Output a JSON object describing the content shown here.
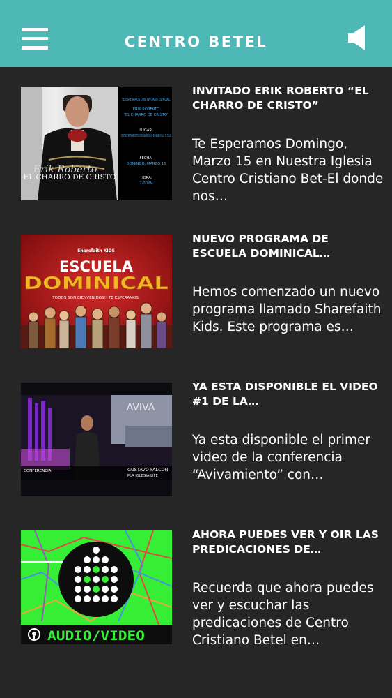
{
  "header": {
    "title": "CENTRO BETEL",
    "menu_icon": "hamburger-menu-icon",
    "sound_icon": "speaker-icon",
    "accent_color": "#4eb8b6"
  },
  "posts": [
    {
      "title": "INVITADO ERIK ROBERTO “EL CHARRO DE CRISTO”",
      "excerpt": "Te Esperamos Domingo, Marzo 15 en Nuestra Iglesia Centro Cristiano Bet-El donde nos…",
      "thumb": {
        "invite": "TE ESPERAMOS CON INVITADO ESPECIAL:",
        "guest": "ERIK ROBERTO",
        "nickname": "\"EL CHARRO DE CRISTO\"",
        "place_label": "LUGAR:",
        "place": "CENTRO CRISTIANO BET-EL 8500 GRAVER BLVD RICHLAND HILLS, TX 76118",
        "date_label": "FECHA:",
        "date": "DOMINGO, MARZO 15",
        "time_label": "HORA:",
        "time": "2:00PM",
        "name_script": "Erik Roberto",
        "name_caption": "EL CHARRO DE CRISTO"
      }
    },
    {
      "title": "NUEVO PROGRAMA DE ESCUELA DOMINICAL…",
      "excerpt": "Hemos comenzado un nuevo programa llamado Sharefaith Kids. Este programa es…",
      "thumb": {
        "brand": "Sharefaith KIDS",
        "line1": "ESCUELA",
        "line2": "DOMINICAL",
        "tagline": "TODOS SON BIENVENIDOS!! TE ESPERAMOS."
      }
    },
    {
      "title": "YA ESTA DISPONIBLE EL VIDEO #1 DE LA…",
      "excerpt": "Ya esta disponible el primer video de la conferencia “Avivamiento” con…",
      "thumb": {
        "screen_text": "AVIVA",
        "left_caption": "CONFERENCIA",
        "speaker": "GUSTAVO FALCON",
        "church": "PLA IGLESIA LIFE"
      }
    },
    {
      "title": "AHORA PUEDES VER Y OIR LAS PREDICACIONES DE…",
      "excerpt": "Recuerda que ahora puedes ver y escuchar las predicaciones de Centro Cristiano Betel en…",
      "thumb": {
        "label": "AUDIO/VIDEO",
        "icon": "podcast-icon"
      }
    }
  ]
}
